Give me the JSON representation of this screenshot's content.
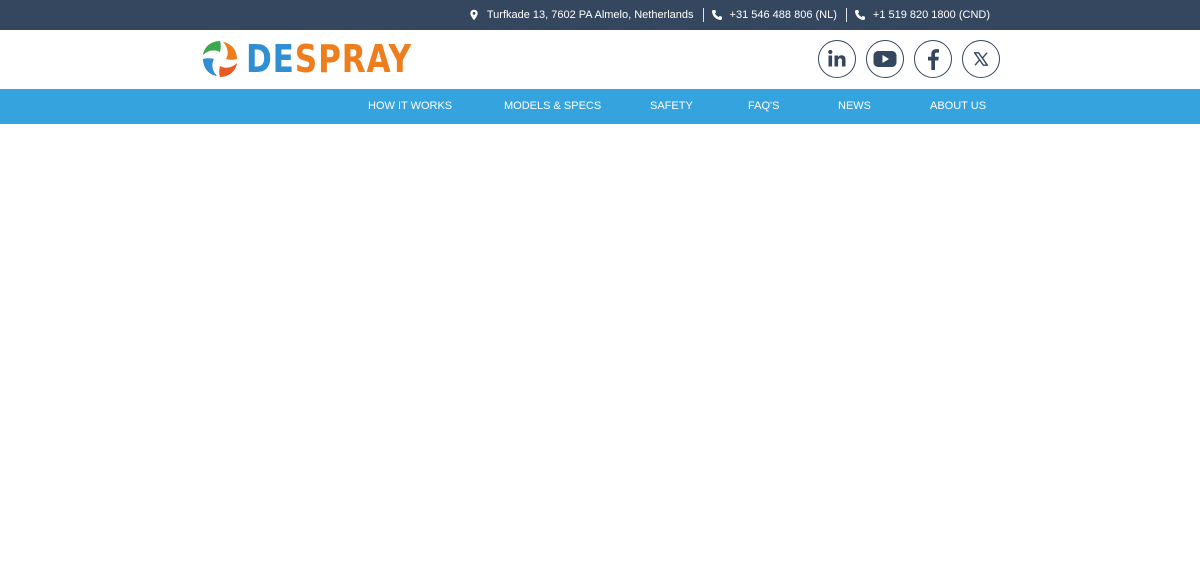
{
  "topbar": {
    "address": "Turfkade 13, 7602 PA Almelo, Netherlands",
    "phone_nl": "+31 546 488 806 (NL)",
    "phone_cnd": "+1 519 820 1800 (CND)"
  },
  "brand": {
    "name_part1": "DE",
    "name_part2": "SPRAY",
    "colors": {
      "blue": "#2f8fd2",
      "orange": "#ee7d1d",
      "green": "#3aa84b"
    }
  },
  "social": {
    "items": [
      {
        "icon": "linkedin-icon",
        "label": "in"
      },
      {
        "icon": "youtube-icon"
      },
      {
        "icon": "facebook-icon",
        "label": "f"
      },
      {
        "icon": "x-icon",
        "label": "X"
      }
    ]
  },
  "nav": {
    "items": [
      {
        "label": "HOW IT WORKS"
      },
      {
        "label": "MODELS & SPECS"
      },
      {
        "label": "SAFETY"
      },
      {
        "label": "FAQ'S"
      },
      {
        "label": "NEWS"
      },
      {
        "label": "ABOUT US"
      }
    ]
  },
  "colors": {
    "topbar_bg": "#34475e",
    "nav_bg": "#34a3de",
    "icon_stroke": "#34475e"
  }
}
